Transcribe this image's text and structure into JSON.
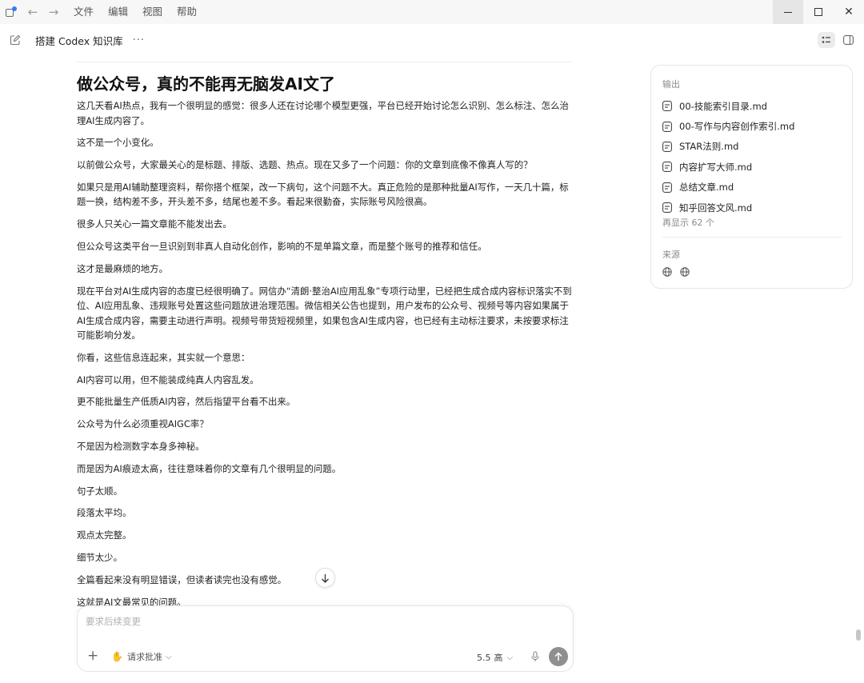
{
  "menu": [
    "文件",
    "编辑",
    "视图",
    "帮助"
  ],
  "header": {
    "thread_title": "搭建 Codex 知识库",
    "more": "···"
  },
  "article": {
    "title": "做公众号，真的不能再无脑发AI文了",
    "paragraphs": [
      "这几天看AI热点，我有一个很明显的感觉：很多人还在讨论哪个模型更强，平台已经开始讨论怎么识别、怎么标注、怎么治理AI生成内容了。",
      "这不是一个小变化。",
      "以前做公众号，大家最关心的是标题、排版、选题、热点。现在又多了一个问题：你的文章到底像不像真人写的？",
      "如果只是用AI辅助整理资料，帮你搭个框架，改一下病句，这个问题不大。真正危险的是那种批量AI写作，一天几十篇，标题一换，结构差不多，开头差不多，结尾也差不多。看起来很勤奋，实际账号风险很高。",
      "很多人只关心一篇文章能不能发出去。",
      "但公众号这类平台一旦识别到非真人自动化创作，影响的不是单篇文章，而是整个账号的推荐和信任。",
      "这才是最麻烦的地方。",
      "现在平台对AI生成内容的态度已经很明确了。网信办“清朗·整治AI应用乱象”专项行动里，已经把生成合成内容标识落实不到位、AI应用乱象、违规账号处置这些问题放进治理范围。微信相关公告也提到，用户发布的公众号、视频号等内容如果属于AI生成合成内容，需要主动进行声明。视频号带货短视频里，如果包含AI生成内容，也已经有主动标注要求，未按要求标注可能影响分发。",
      "你看，这些信息连起来，其实就一个意思：",
      "AI内容可以用，但不能装成纯真人内容乱发。",
      "更不能批量生产低质AI内容，然后指望平台看不出来。",
      "公众号为什么必须重视AIGC率？",
      "不是因为检测数字本身多神秘。",
      "而是因为AI痕迹太高，往往意味着你的文章有几个很明显的问题。",
      "句子太顺。",
      "段落太平均。",
      "观点太完整。",
      "细节太少。",
      "全篇看起来没有明显错误，但读者读完也没有感觉。",
      "这就是AI文最常见的问题。"
    ]
  },
  "composer": {
    "placeholder": "要求后续变更",
    "approval_label": "请求批准",
    "model_version": "5.5",
    "model_level": "高"
  },
  "side_panel": {
    "output_title": "输出",
    "files": [
      "00-技能索引目录.md",
      "00-写作与内容创作索引.md",
      "STAR法则.md",
      "内容扩写大师.md",
      "总结文章.md",
      "知乎回答文风.md"
    ],
    "show_more": "再显示 62 个",
    "source_title": "来源"
  },
  "colors": {
    "accent_dot": "#2f7cf6",
    "send_button": "#8f8f8f"
  }
}
